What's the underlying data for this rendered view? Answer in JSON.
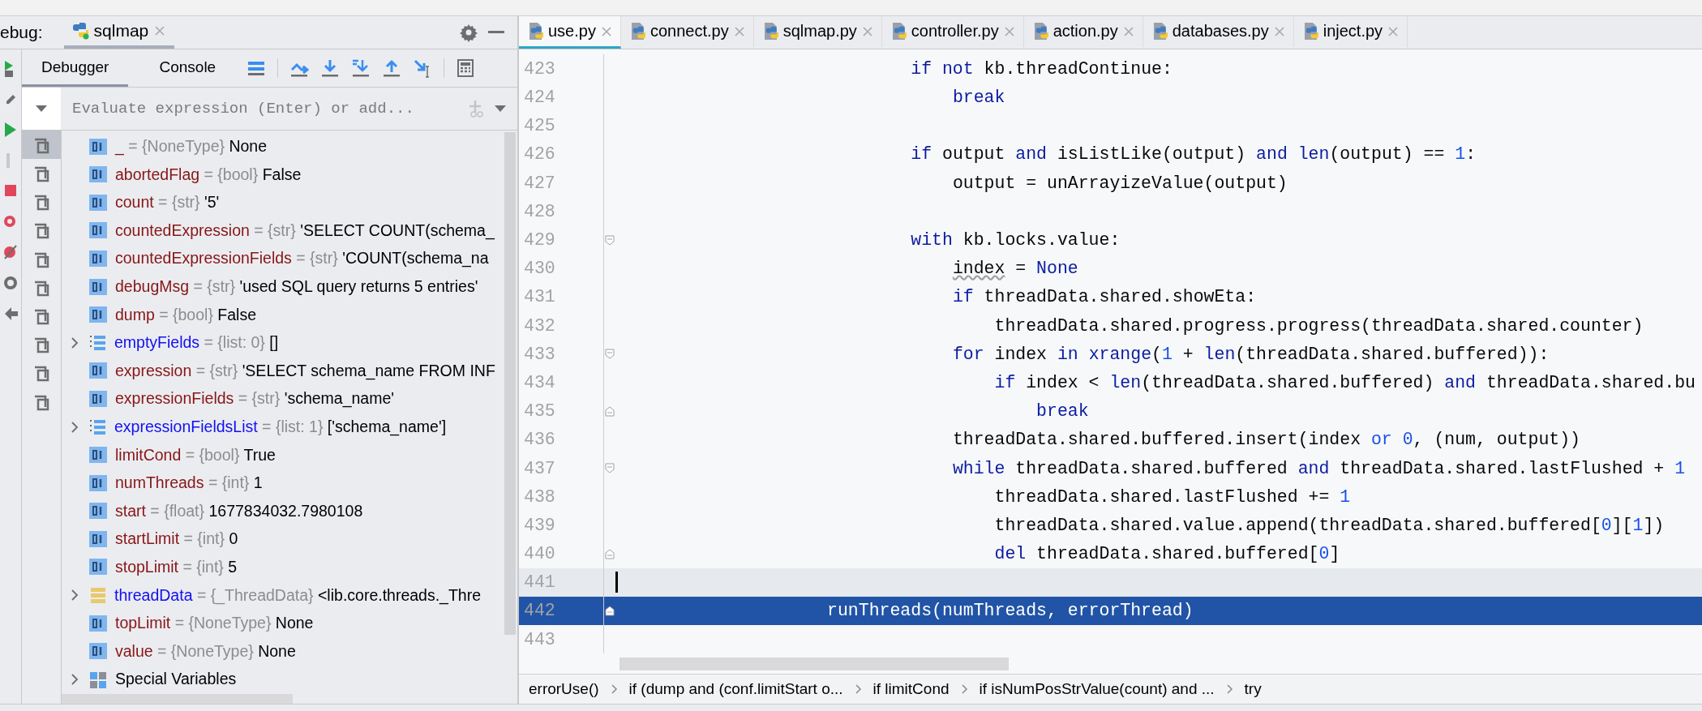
{
  "debug_panel": {
    "title": "ebug:",
    "session_tab": {
      "label": "sqlmap"
    },
    "subtabs": [
      {
        "label": "Debugger",
        "selected": true
      },
      {
        "label": "Console",
        "selected": false
      }
    ],
    "evaluate": {
      "placeholder": "Evaluate expression (Enter) or add..."
    },
    "frames": [
      {
        "selected": true
      },
      {
        "selected": false
      },
      {
        "selected": false
      },
      {
        "selected": false
      },
      {
        "selected": false
      },
      {
        "selected": false
      },
      {
        "selected": false
      },
      {
        "selected": false
      },
      {
        "selected": false
      },
      {
        "selected": false
      }
    ],
    "variables": [
      {
        "name": "_",
        "type": "= {NoneType}",
        "value": "None",
        "kind": "scalar",
        "expandable": false
      },
      {
        "name": "abortedFlag",
        "type": "= {bool}",
        "value": "False",
        "kind": "scalar",
        "expandable": false
      },
      {
        "name": "count",
        "type": "= {str}",
        "value": "'5'",
        "kind": "scalar",
        "expandable": false
      },
      {
        "name": "countedExpression",
        "type": "= {str}",
        "value": "'SELECT COUNT(schema_",
        "kind": "scalar",
        "expandable": false
      },
      {
        "name": "countedExpressionFields",
        "type": "= {str}",
        "value": "'COUNT(schema_na",
        "kind": "scalar",
        "expandable": false
      },
      {
        "name": "debugMsg",
        "type": "= {str}",
        "value": "'used SQL query returns 5 entries'",
        "kind": "scalar",
        "expandable": false
      },
      {
        "name": "dump",
        "type": "= {bool}",
        "value": "False",
        "kind": "scalar",
        "expandable": false
      },
      {
        "name": "emptyFields",
        "type": "= {list: 0}",
        "value": "[]",
        "kind": "list",
        "expandable": true
      },
      {
        "name": "expression",
        "type": "= {str}",
        "value": "'SELECT schema_name FROM INF",
        "kind": "scalar",
        "expandable": false
      },
      {
        "name": "expressionFields",
        "type": "= {str}",
        "value": "'schema_name'",
        "kind": "scalar",
        "expandable": false
      },
      {
        "name": "expressionFieldsList",
        "type": "= {list: 1}",
        "value": "['schema_name']",
        "kind": "list",
        "expandable": true
      },
      {
        "name": "limitCond",
        "type": "= {bool}",
        "value": "True",
        "kind": "scalar",
        "expandable": false
      },
      {
        "name": "numThreads",
        "type": "= {int}",
        "value": "1",
        "kind": "scalar",
        "expandable": false
      },
      {
        "name": "start",
        "type": "= {float}",
        "value": "1677834032.7980108",
        "kind": "scalar",
        "expandable": false
      },
      {
        "name": "startLimit",
        "type": "= {int}",
        "value": "0",
        "kind": "scalar",
        "expandable": false
      },
      {
        "name": "stopLimit",
        "type": "= {int}",
        "value": "5",
        "kind": "scalar",
        "expandable": false
      },
      {
        "name": "threadData",
        "type": "= {_ThreadData}",
        "value": "<lib.core.threads._Thre",
        "kind": "object",
        "expandable": true
      },
      {
        "name": "topLimit",
        "type": "= {NoneType}",
        "value": "None",
        "kind": "scalar",
        "expandable": false
      },
      {
        "name": "value",
        "type": "= {NoneType}",
        "value": "None",
        "kind": "scalar",
        "expandable": false
      },
      {
        "name": "Special Variables",
        "kind": "special",
        "expandable": true
      }
    ]
  },
  "editor": {
    "tabs": [
      {
        "label": "use.py",
        "selected": true
      },
      {
        "label": "connect.py",
        "selected": false
      },
      {
        "label": "sqlmap.py",
        "selected": false
      },
      {
        "label": "controller.py",
        "selected": false
      },
      {
        "label": "action.py",
        "selected": false
      },
      {
        "label": "databases.py",
        "selected": false
      },
      {
        "label": "inject.py",
        "selected": false
      }
    ],
    "lines": [
      {
        "number": "423",
        "segments": [
          {
            "text": "                            if not",
            "kind": "kw"
          },
          {
            "text": " kb.threadContinue:",
            "kind": "plain"
          }
        ]
      },
      {
        "number": "424",
        "segments": [
          {
            "text": "                                break",
            "kind": "kw"
          }
        ]
      },
      {
        "number": "425"
      },
      {
        "number": "426",
        "segments": [
          {
            "text": "                            if",
            "kind": "kw"
          },
          {
            "text": " output ",
            "kind": "plain"
          },
          {
            "text": "and",
            "kind": "kw"
          },
          {
            "text": " isListLike(output) ",
            "kind": "plain"
          },
          {
            "text": "and len",
            "kind": "kw"
          },
          {
            "text": "(output) == ",
            "kind": "plain"
          },
          {
            "text": "1",
            "kind": "num"
          },
          {
            "text": ":",
            "kind": "plain"
          }
        ]
      },
      {
        "number": "427",
        "segments": [
          {
            "text": "                                output = unArrayizeValue(output)",
            "kind": "plain"
          }
        ]
      },
      {
        "number": "428"
      },
      {
        "number": "429",
        "fold_start": true,
        "segments": [
          {
            "text": "                            with",
            "kind": "kw"
          },
          {
            "text": " kb.locks.value:",
            "kind": "plain"
          }
        ]
      },
      {
        "number": "430",
        "segments": [
          {
            "text": "                                index",
            "kind": "warn"
          },
          {
            "text": " = ",
            "kind": "plain"
          },
          {
            "text": "None",
            "kind": "kw"
          }
        ]
      },
      {
        "number": "431",
        "segments": [
          {
            "text": "                                if",
            "kind": "kw"
          },
          {
            "text": " threadData.shared.showEta:",
            "kind": "plain"
          }
        ]
      },
      {
        "number": "432",
        "segments": [
          {
            "text": "                                    threadData.shared.progress.progress(threadData.shared.counter)",
            "kind": "plain"
          }
        ]
      },
      {
        "number": "433",
        "fold_start": true,
        "segments": [
          {
            "text": "                                for",
            "kind": "kw"
          },
          {
            "text": " index ",
            "kind": "plain"
          },
          {
            "text": "in xrange",
            "kind": "kw"
          },
          {
            "text": "(",
            "kind": "plain"
          },
          {
            "text": "1",
            "kind": "num"
          },
          {
            "text": " + ",
            "kind": "plain"
          },
          {
            "text": "len",
            "kind": "kw"
          },
          {
            "text": "(threadData.shared.buffered)):",
            "kind": "plain"
          }
        ]
      },
      {
        "number": "434",
        "segments": [
          {
            "text": "                                    if",
            "kind": "kw"
          },
          {
            "text": " index < ",
            "kind": "plain"
          },
          {
            "text": "len",
            "kind": "kw"
          },
          {
            "text": "(threadData.shared.buffered) ",
            "kind": "plain"
          },
          {
            "text": "and",
            "kind": "kw"
          },
          {
            "text": " threadData.shared.bu",
            "kind": "plain"
          }
        ]
      },
      {
        "number": "435",
        "fold_end": true,
        "segments": [
          {
            "text": "                                        break",
            "kind": "kw"
          }
        ]
      },
      {
        "number": "436",
        "segments": [
          {
            "text": "                                threadData.shared.buffered.insert(index ",
            "kind": "plain"
          },
          {
            "text": "or 0",
            "kind": "num"
          },
          {
            "text": ", (num, output))",
            "kind": "plain"
          }
        ]
      },
      {
        "number": "437",
        "fold_start": true,
        "segments": [
          {
            "text": "                                while",
            "kind": "kw"
          },
          {
            "text": " threadData.shared.buffered ",
            "kind": "plain"
          },
          {
            "text": "and",
            "kind": "kw"
          },
          {
            "text": " threadData.shared.lastFlushed + ",
            "kind": "plain"
          },
          {
            "text": "1",
            "kind": "num"
          }
        ]
      },
      {
        "number": "438",
        "segments": [
          {
            "text": "                                    threadData.shared.lastFlushed += ",
            "kind": "plain"
          },
          {
            "text": "1",
            "kind": "num"
          }
        ]
      },
      {
        "number": "439",
        "segments": [
          {
            "text": "                                    threadData.shared.value.append(threadData.shared.buffered[",
            "kind": "plain"
          },
          {
            "text": "0",
            "kind": "num"
          },
          {
            "text": "][",
            "kind": "plain"
          },
          {
            "text": "1",
            "kind": "num"
          },
          {
            "text": "])",
            "kind": "plain"
          }
        ]
      },
      {
        "number": "440",
        "fold_end": true,
        "segments": [
          {
            "text": "                                    del",
            "kind": "kw"
          },
          {
            "text": " threadData.shared.buffered[",
            "kind": "plain"
          },
          {
            "text": "0",
            "kind": "num"
          },
          {
            "text": "]",
            "kind": "plain"
          }
        ]
      },
      {
        "number": "441",
        "caret": true
      },
      {
        "number": "442",
        "selected": true,
        "fold_end": true,
        "segments": [
          {
            "text": "                    runThreads(numThreads, errorThread)",
            "kind": "plain"
          }
        ]
      },
      {
        "number": "443"
      }
    ]
  },
  "breadcrumbs": [
    "errorUse()",
    "if (dump and (conf.limitStart o...",
    "if limitCond",
    "if isNumPosStrValue(count) and ...",
    "try"
  ]
}
